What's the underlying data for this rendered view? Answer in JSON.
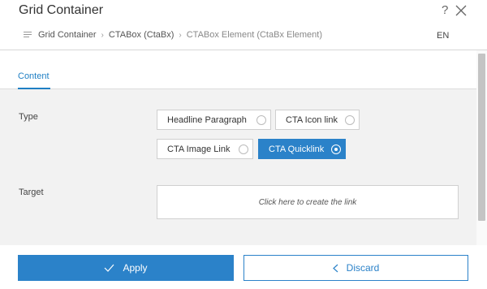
{
  "dialog": {
    "title": "Grid Container",
    "help_glyph": "?",
    "language": "EN"
  },
  "breadcrumb": {
    "items": [
      "Grid Container",
      "CTABox (CtaBx)",
      "CTABox Element (CtaBx Element)"
    ],
    "separator": "›"
  },
  "tabs": [
    {
      "label": "Content",
      "active": true
    }
  ],
  "fields": {
    "type": {
      "label": "Type",
      "options": [
        {
          "label": "Headline Paragraph",
          "selected": false
        },
        {
          "label": "CTA Icon link",
          "selected": false
        },
        {
          "label": "CTA Image Link",
          "selected": false
        },
        {
          "label": "CTA Quicklink",
          "selected": true
        }
      ]
    },
    "target": {
      "label": "Target",
      "placeholder": "Click here to create the link"
    }
  },
  "footer": {
    "apply_label": "Apply",
    "discard_label": "Discard"
  },
  "colors": {
    "accent": "#2b82c9",
    "tab_active": "#1f7fc4"
  }
}
